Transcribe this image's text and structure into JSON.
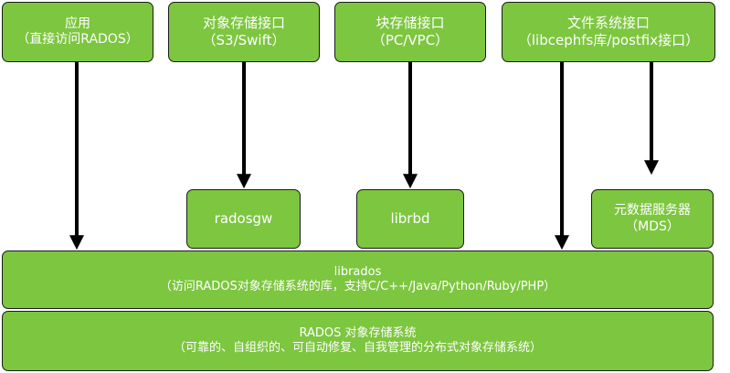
{
  "boxes": {
    "app": {
      "line1": "应用",
      "line2": "（直接访问RADOS）"
    },
    "object_storage": {
      "line1": "对象存储接口",
      "line2": "（S3/Swift）"
    },
    "block_storage": {
      "line1": "块存储接口",
      "line2": "（PC/VPC）"
    },
    "file_system": {
      "line1": "文件系统接口",
      "line2": "（libcephfs库/postfix接口）"
    },
    "radosgw": {
      "label": "radosgw"
    },
    "librbd": {
      "label": "librbd"
    },
    "mds": {
      "line1": "元数据服务器",
      "line2": "（MDS）"
    },
    "librados": {
      "line1": "librados",
      "line2": "（访问RADOS对象存储系统的库，支持C/C++/Java/Python/Ruby/PHP）"
    },
    "rados": {
      "line1": "RADOS 对象存储系统",
      "line2": "（可靠的、自组织的、可自动修复、自我管理的分布式对象存储系统）"
    }
  },
  "colors": {
    "box_fill": "#7dc640",
    "border": "#1a1a1a",
    "arrow": "#000000",
    "text": "#ffffff"
  }
}
